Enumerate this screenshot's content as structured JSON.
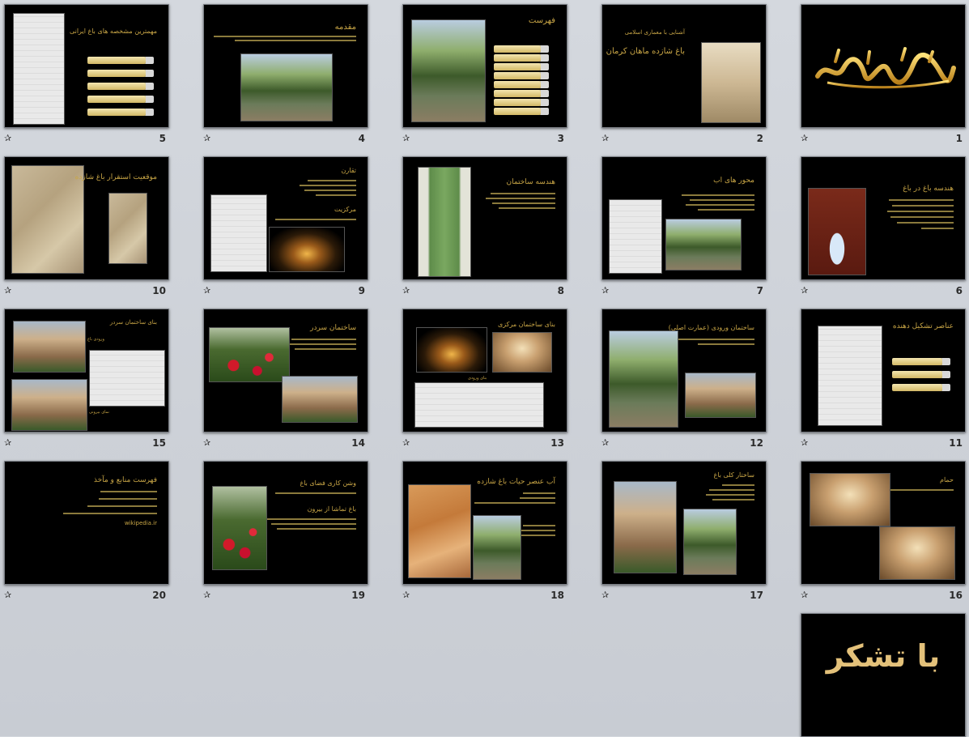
{
  "slides": [
    {
      "number": "1",
      "title": ""
    },
    {
      "number": "2",
      "title": "باغ شازده ماهان کرمان"
    },
    {
      "number": "3",
      "title": "فهرست"
    },
    {
      "number": "4",
      "title": "مقدمه"
    },
    {
      "number": "5",
      "title": "مهمترین مشخصه های باغ ایرانی"
    },
    {
      "number": "6",
      "title": "هندسه باغ در باغ"
    },
    {
      "number": "7",
      "title": "محور های اب"
    },
    {
      "number": "8",
      "title": "هندسه ساختمان"
    },
    {
      "number": "9",
      "title": "تقارن"
    },
    {
      "number": "10",
      "title": "موقعیت استقرار باغ شازده"
    },
    {
      "number": "11",
      "title": "عناصر تشکیل دهنده"
    },
    {
      "number": "12",
      "title": "ساختمان ورودی (عمارت اصلی)"
    },
    {
      "number": "13",
      "title": "بنای ساختمان مرکزی"
    },
    {
      "number": "14",
      "title": "ساختمان سردر"
    },
    {
      "number": "15",
      "title": "بنای ساختمان سردر"
    },
    {
      "number": "16",
      "title": "حمام"
    },
    {
      "number": "17",
      "title": "ساختار کلی باغ"
    },
    {
      "number": "18",
      "title": "آب عنصر حیات باغ شازده"
    },
    {
      "number": "19",
      "title": "وشن کاری فضای باغ"
    },
    {
      "number": "20",
      "title": "فهرست منابع و مآخذ"
    },
    {
      "number": "",
      "title": "",
      "text": "با تشکر"
    }
  ],
  "slide2_subtitle": "آشنایی با معماری اسلامی",
  "slide9_subtitle": "مرکزیت",
  "slide19_subtitle": "باغ تماشا از بیرون",
  "slide20_url": "wikipedia.ir",
  "slide13_caption": "بنای ورودی",
  "slide15_caption_1": "ورودی باغ",
  "slide15_caption_2": "نمای بیرونی",
  "star_glyph": "✰"
}
